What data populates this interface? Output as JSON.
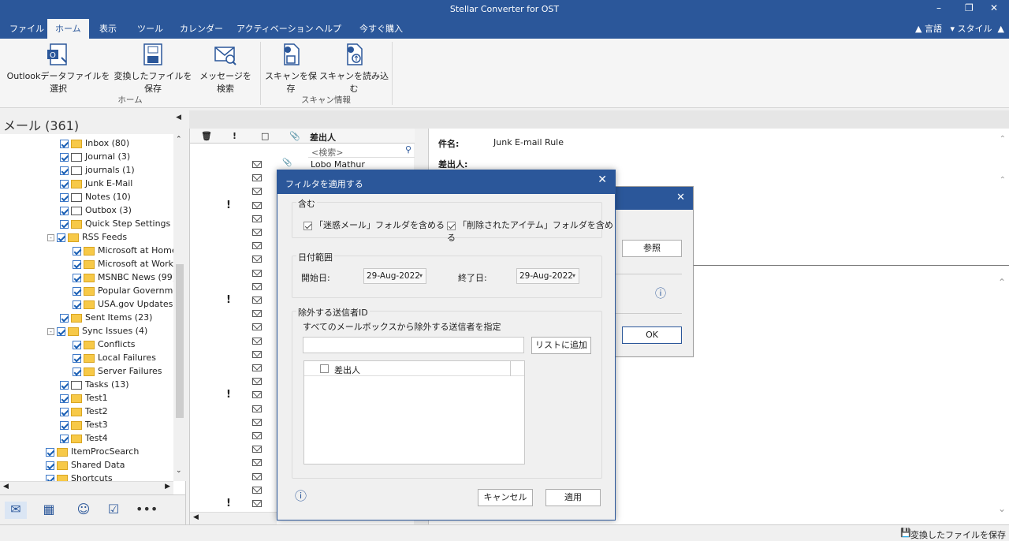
{
  "window": {
    "title": "Stellar Converter for OST"
  },
  "menu": {
    "tabs": [
      "ファイル",
      "ホーム",
      "表示",
      "ツール",
      "カレンダー",
      "アクティベーション",
      "ヘルプ",
      "今すぐ購入"
    ],
    "active": "ホーム",
    "language": "言語",
    "style": "スタイル"
  },
  "ribbon": {
    "select_outlook": "Outlookデータファイルを選択",
    "save_converted": "変換したファイルを保存",
    "search_messages": "メッセージを検索",
    "save_scan": "スキャンを保存",
    "load_scan": "スキャンを読み込む",
    "group_home": "ホーム",
    "group_scan": "スキャン情報"
  },
  "left": {
    "header": "メール (361)",
    "tree": [
      {
        "label": "Inbox (80)",
        "indent": 0
      },
      {
        "label": "Journal (3)",
        "indent": 0
      },
      {
        "label": "journals (1)",
        "indent": 0
      },
      {
        "label": "Junk E-Mail",
        "indent": 0
      },
      {
        "label": "Notes (10)",
        "indent": 0
      },
      {
        "label": "Outbox (3)",
        "indent": 0
      },
      {
        "label": "Quick Step Settings",
        "indent": 0
      },
      {
        "label": "RSS Feeds",
        "indent": 0
      },
      {
        "label": "Microsoft at Home",
        "indent": 1
      },
      {
        "label": "Microsoft at Work",
        "indent": 1
      },
      {
        "label": "MSNBC News (99)",
        "indent": 1
      },
      {
        "label": "Popular Government",
        "indent": 1
      },
      {
        "label": "USA.gov Updates:",
        "indent": 1
      },
      {
        "label": "Sent Items (23)",
        "indent": 0
      },
      {
        "label": "Sync Issues (4)",
        "indent": 0
      },
      {
        "label": "Conflicts",
        "indent": 1
      },
      {
        "label": "Local Failures",
        "indent": 1
      },
      {
        "label": "Server Failures",
        "indent": 1
      },
      {
        "label": "Tasks (13)",
        "indent": 0
      },
      {
        "label": "Test1",
        "indent": 0
      },
      {
        "label": "Test2",
        "indent": 0
      },
      {
        "label": "Test3",
        "indent": 0
      },
      {
        "label": "Test4",
        "indent": 0
      },
      {
        "label": "ItemProcSearch",
        "indent": -1
      },
      {
        "label": "Shared Data",
        "indent": -1
      },
      {
        "label": "Shortcuts",
        "indent": -1
      }
    ]
  },
  "list": {
    "col_from": "差出人",
    "search_placeholder": "<検索>",
    "first_sender": "Lobo Mathur"
  },
  "reading": {
    "subject_label": "件名:",
    "subject_value": "Junk E-mail Rule",
    "from_label": "差出人:"
  },
  "bg_dialog": {
    "browse": "参照",
    "ok": "OK"
  },
  "dialog": {
    "title": "フィルタを適用する",
    "include_group": "含む",
    "include_junk": "「迷惑メール」フォルダを含める",
    "include_deleted": "「削除されたアイテム」フォルダを含める",
    "date_group": "日付範囲",
    "start_label": "開始日:",
    "start_value": "29-Aug-2022",
    "end_label": "終了日:",
    "end_value": "29-Aug-2022",
    "exclude_group": "除外する送信者ID",
    "exclude_desc": "すべてのメールボックスから除外する送信者を指定",
    "add_to_list": "リストに追加",
    "sender_col": "差出人",
    "cancel": "キャンセル",
    "apply": "適用"
  },
  "status": {
    "save_converted": "変換したファイルを保存"
  }
}
